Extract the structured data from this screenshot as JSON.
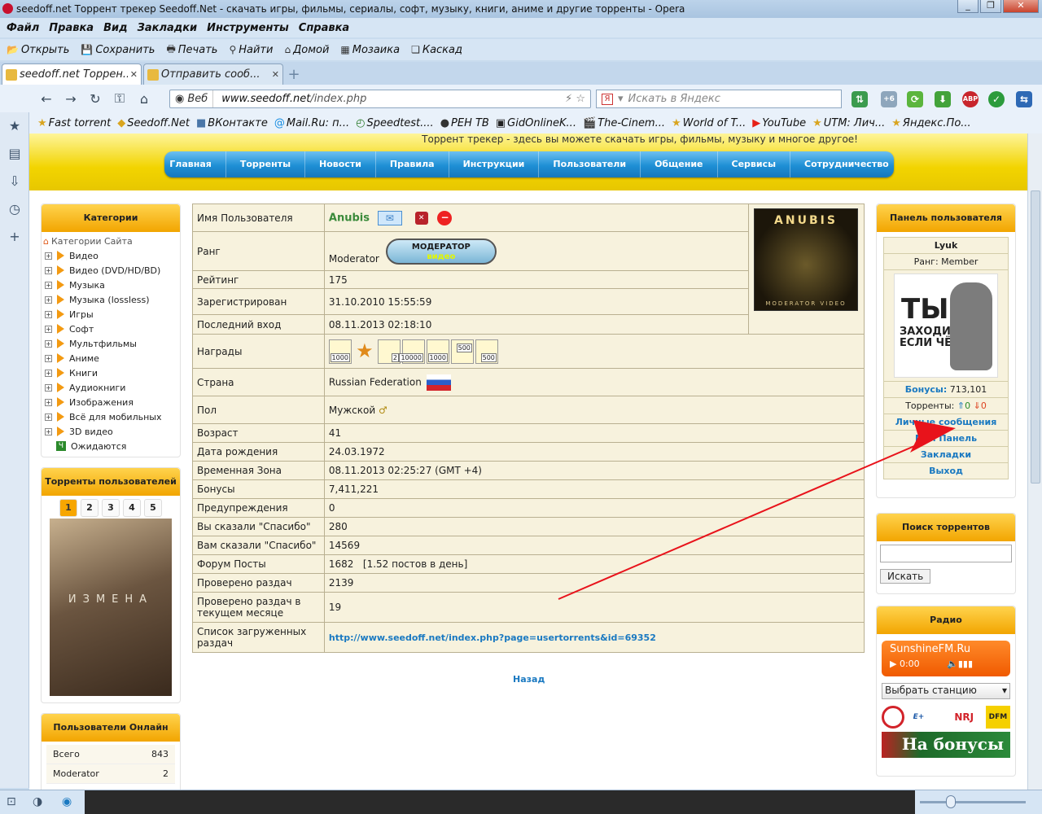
{
  "window": {
    "title": "seedoff.net Торрент трекер Seedoff.Net - скачать игры, фильмы, сериалы, софт, музыку, книги, аниме и другие торренты - Opera"
  },
  "menu": [
    "Файл",
    "Правка",
    "Вид",
    "Закладки",
    "Инструменты",
    "Справка"
  ],
  "toolbar": [
    "Открыть",
    "Сохранить",
    "Печать",
    "Найти",
    "Домой",
    "Мозаика",
    "Каскад"
  ],
  "tabs": [
    {
      "label": "seedoff.net Торрен..."
    },
    {
      "label": "Отправить сооб..."
    }
  ],
  "address": {
    "mode": "Веб",
    "url_host": "www.seedoff.net",
    "url_path": "/index.php"
  },
  "search": {
    "placeholder": "Искать в Яндекс"
  },
  "extensions": {
    "badge": "+6",
    "adblock": "ABP"
  },
  "bookmarks": [
    "Fast torrent",
    "Seedoff.Net",
    "ВКонтакте",
    "Mail.Ru: п...",
    "Speedtest....",
    "РЕН ТВ",
    "GidOnlineK...",
    "The-Cinem...",
    "World of T...",
    "YouTube",
    "UTM: Лич...",
    "Яндекс.По..."
  ],
  "site": {
    "slogan": "Торрент трекер - здесь вы можете скачать игры, фильмы, музыку и многое другое!",
    "nav": [
      "Главная",
      "Торренты",
      "Новости",
      "Правила",
      "Инструкции",
      "Пользователи",
      "Общение",
      "Сервисы",
      "Сотрудничество"
    ]
  },
  "categories": {
    "title": "Категории",
    "root": "Категории Сайта",
    "items": [
      "Видео",
      "Видео (DVD/HD/BD)",
      "Музыка",
      "Музыка (lossless)",
      "Игры",
      "Софт",
      "Мультфильмы",
      "Аниме",
      "Книги",
      "Аудиокниги",
      "Изображения",
      "Всё для мобильных",
      "3D видео"
    ],
    "waiting": "Ожидаются"
  },
  "user_torrents": {
    "title": "Торренты пользователей",
    "pages": [
      "1",
      "2",
      "3",
      "4",
      "5"
    ],
    "poster_title": "ИЗМЕНА"
  },
  "online": {
    "title": "Пользователи Онлайн",
    "rows": [
      {
        "label": "Всего",
        "value": "843"
      },
      {
        "label": "Moderator",
        "value": "2"
      }
    ]
  },
  "profile": {
    "rows": [
      {
        "key": "Имя Пользователя",
        "value": "Anubis"
      },
      {
        "key": "Ранг",
        "value": "Moderator"
      },
      {
        "key": "Рейтинг",
        "value": "175"
      },
      {
        "key": "Зарегистрирован",
        "value": "31.10.2010 15:55:59"
      },
      {
        "key": "Последний вход",
        "value": "08.11.2013 02:18:10"
      },
      {
        "key": "Награды",
        "value": ""
      },
      {
        "key": "Страна",
        "value": "Russian Federation"
      },
      {
        "key": "Пол",
        "value": "Мужской"
      },
      {
        "key": "Возраст",
        "value": "41"
      },
      {
        "key": "Дата рождения",
        "value": "24.03.1972"
      },
      {
        "key": "Временная Зона",
        "value": "08.11.2013 02:25:27 (GMT +4)"
      },
      {
        "key": "Бонусы",
        "value": "7,411,221"
      },
      {
        "key": "Предупреждения",
        "value": "0"
      },
      {
        "key": "Вы сказали \"Спасибо\"",
        "value": "280"
      },
      {
        "key": "Вам сказали \"Спасибо\"",
        "value": "14569"
      },
      {
        "key": "Форум Посты",
        "value": "1682   [1.52 постов в день]"
      },
      {
        "key": "Проверено раздач",
        "value": "2139"
      },
      {
        "key": "Проверено раздач в текущем месяце",
        "value": "19"
      },
      {
        "key": "Список загруженных раздач",
        "value": "http://www.seedoff.net/index.php?page=usertorrents&id=69352"
      }
    ],
    "rank_badge": {
      "line1": "МОДЕРАТОР",
      "line2": "видео"
    },
    "avatar": {
      "title": "ANUBIS",
      "caption": "MODERATOR VIDEO"
    },
    "awards": [
      "1000",
      "",
      "2",
      "10000",
      "1000",
      "500",
      "500"
    ],
    "back": "Назад"
  },
  "user_panel": {
    "title": "Панель пользователя",
    "username": "Lyuk",
    "rank": "Ранг: Member",
    "avatar_text1": "ТЫ",
    "avatar_text2": "ЗАХОДИ, ЕСЛИ ЧЁ",
    "bonus_label": "Бонусы:",
    "bonus_value": "713,101",
    "torrents_label": "Торренты:",
    "seed": "0",
    "leech": "0",
    "links": [
      "Личные сообщения",
      "Моя Панель",
      "Закладки",
      "Выход"
    ]
  },
  "search_panel": {
    "title": "Поиск торрентов",
    "button": "Искать"
  },
  "radio_panel": {
    "title": "Радио",
    "station": "SunshineFM.Ru",
    "time": "0:00",
    "select": "Выбрать станцию",
    "banner": "На бонусы"
  },
  "colors": {
    "accent": "#f2a500",
    "nav": "#1e8fd5",
    "link": "#1a79c1",
    "arrow": "#e8131b"
  }
}
